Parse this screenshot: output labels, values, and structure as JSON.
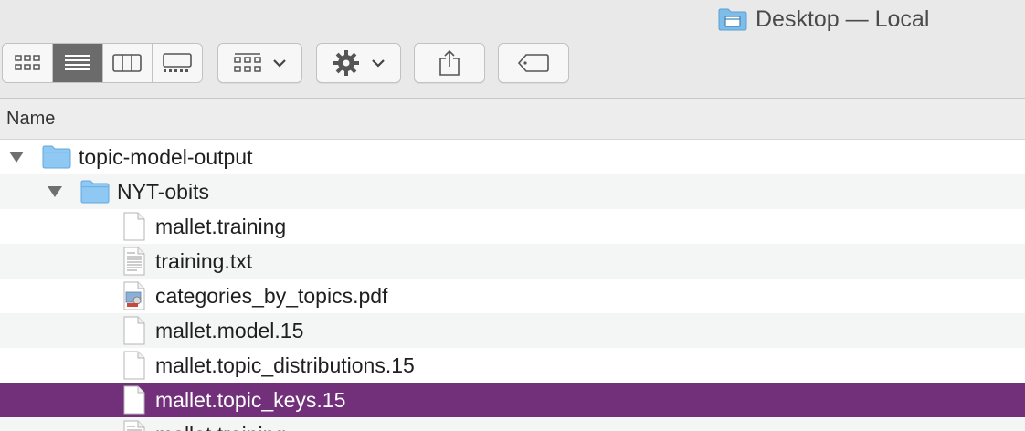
{
  "window": {
    "title": "Desktop — Local"
  },
  "toolbar": {
    "view_modes": [
      "icon-view",
      "list-view",
      "column-view",
      "gallery-view"
    ],
    "active_view": "list-view",
    "buttons": [
      "group-by",
      "action-gear",
      "share",
      "tags"
    ]
  },
  "list": {
    "column_header": "Name",
    "items": [
      {
        "label": "topic-model-output",
        "kind": "folder",
        "level": 0,
        "expanded": true
      },
      {
        "label": "NYT-obits",
        "kind": "folder",
        "level": 1,
        "expanded": true
      },
      {
        "label": "mallet.training",
        "kind": "file",
        "level": 2
      },
      {
        "label": "training.txt",
        "kind": "text",
        "level": 2
      },
      {
        "label": "categories_by_topics.pdf",
        "kind": "pdf",
        "level": 2
      },
      {
        "label": "mallet.model.15",
        "kind": "file",
        "level": 2
      },
      {
        "label": "mallet.topic_distributions.15",
        "kind": "file",
        "level": 2
      },
      {
        "label": "mallet.topic_keys.15",
        "kind": "file",
        "level": 2,
        "selected": true
      },
      {
        "label": "mallet.training",
        "kind": "text",
        "level": 2
      }
    ]
  },
  "colors": {
    "selection": "#722f7a",
    "folder": "#8fc8f2",
    "toolbar_bg": "#e9e9e9"
  }
}
